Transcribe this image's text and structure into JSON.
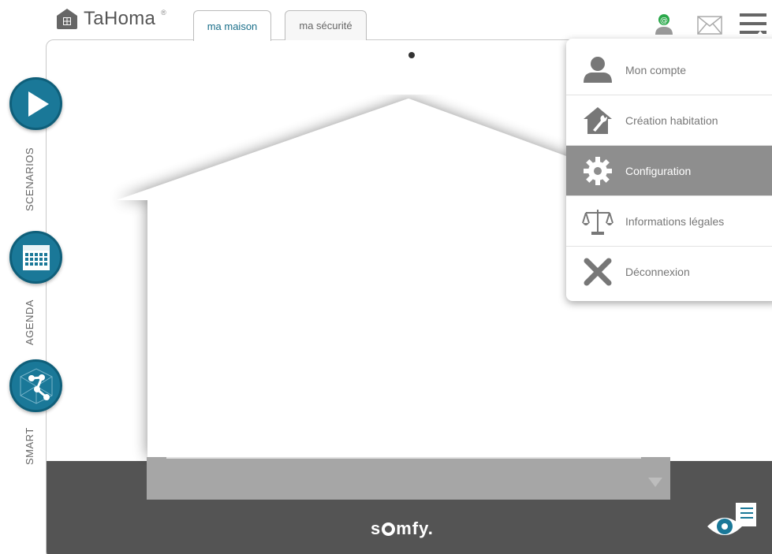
{
  "header": {
    "brand": "TaHoma",
    "brand_reg": "®",
    "tabs": [
      {
        "label": "ma maison",
        "active": true
      },
      {
        "label": "ma sécurité",
        "active": false
      }
    ],
    "icons": [
      "home-logo-icon",
      "user-online-icon",
      "mail-icon",
      "hamburger-menu-icon"
    ]
  },
  "sidebar": {
    "items": [
      {
        "label": "SCENARIOS",
        "icon": "play-icon"
      },
      {
        "label": "AGENDA",
        "icon": "calendar-icon"
      },
      {
        "label": "SMART",
        "icon": "network-icon"
      }
    ]
  },
  "menu": {
    "items": [
      {
        "label": "Mon compte",
        "icon": "user-icon",
        "active": false
      },
      {
        "label": "Création habitation",
        "icon": "house-wrench-icon",
        "active": false
      },
      {
        "label": "Configuration",
        "icon": "gear-icon",
        "active": true
      },
      {
        "label": "Informations légales",
        "icon": "scales-icon",
        "active": false
      },
      {
        "label": "Déconnexion",
        "icon": "close-icon",
        "active": false
      }
    ]
  },
  "footer": {
    "brand_prefix": "s",
    "brand_suffix": "mfy",
    "brand_dot": "."
  },
  "colors": {
    "accent": "#1a7898",
    "accent_dark": "#0f5f7a",
    "menu_active": "#8e8e8e",
    "bottom_bar": "#545454",
    "online": "#2aa84a"
  }
}
